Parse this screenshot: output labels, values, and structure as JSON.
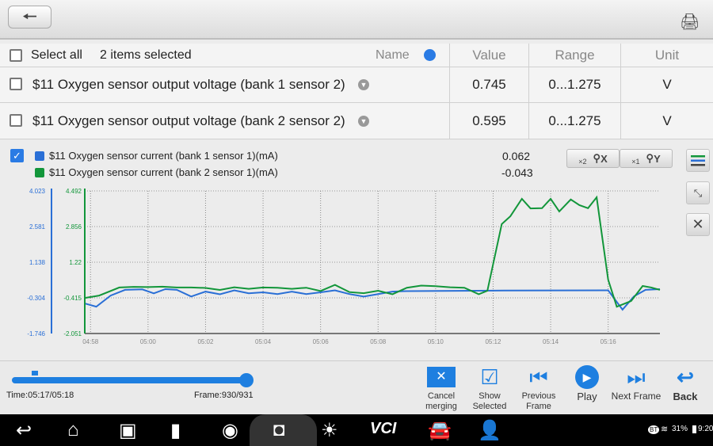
{
  "header": {
    "back_icon": "back-arrow-icon",
    "print_icon": "printer-icon"
  },
  "table": {
    "select_all": "Select all",
    "selected_count": "2 items selected",
    "columns": {
      "name": "Name",
      "value": "Value",
      "range": "Range",
      "unit": "Unit"
    },
    "rows": [
      {
        "name": "$11 Oxygen sensor output voltage (bank 1 sensor 2)",
        "value": "0.745",
        "range": "0...1.275",
        "unit": "V"
      },
      {
        "name": "$11 Oxygen sensor output voltage (bank 2 sensor 2)",
        "value": "0.595",
        "range": "0...1.275",
        "unit": "V"
      }
    ]
  },
  "graph": {
    "legend": [
      {
        "label": "$11 Oxygen sensor current (bank 1 sensor 1)(mA)",
        "value": "0.062",
        "color": "#2a6fd6"
      },
      {
        "label": "$11 Oxygen sensor current (bank 2 sensor 1)(mA)",
        "value": "-0.043",
        "color": "#12963a"
      }
    ],
    "zoom_x": {
      "mult": "×2",
      "label": "X"
    },
    "zoom_y": {
      "mult": "×1",
      "label": "Y"
    }
  },
  "chart_data": {
    "type": "line",
    "x_ticks": [
      "04:58",
      "05:00",
      "05:02",
      "05:04",
      "05:06",
      "05:08",
      "05:10",
      "05:12",
      "05:14",
      "05:16"
    ],
    "xlim": [
      "04:57.8",
      "05:17.8"
    ],
    "grid": true,
    "series": [
      {
        "name": "$11 Oxygen sensor current (bank 1 sensor 1)(mA)",
        "color": "#2a6fd6",
        "ylim": [
          -1.746,
          4.023
        ],
        "y_ticks": [
          "4.023",
          "2.581",
          "1.138",
          "-0.304",
          "-1.746"
        ],
        "points": [
          [
            "04:57.8",
            -0.53
          ],
          [
            "04:58.2",
            -0.66
          ],
          [
            "04:58.7",
            -0.21
          ],
          [
            "04:59.2",
            0.02
          ],
          [
            "04:59.8",
            0.04
          ],
          [
            "05:00.2",
            -0.12
          ],
          [
            "05:00.6",
            0.05
          ],
          [
            "05:01.0",
            0.02
          ],
          [
            "05:01.5",
            -0.25
          ],
          [
            "05:02.0",
            -0.05
          ],
          [
            "05:02.5",
            -0.16
          ],
          [
            "05:03.0",
            0.0
          ],
          [
            "05:03.5",
            -0.12
          ],
          [
            "05:04.0",
            -0.08
          ],
          [
            "05:04.5",
            -0.15
          ],
          [
            "05:05.0",
            -0.05
          ],
          [
            "05:05.5",
            -0.15
          ],
          [
            "05:06.0",
            -0.08
          ],
          [
            "05:06.5",
            0.0
          ],
          [
            "05:07.0",
            -0.15
          ],
          [
            "05:07.5",
            -0.25
          ],
          [
            "05:08.0",
            -0.15
          ],
          [
            "05:08.5",
            -0.05
          ],
          [
            "05:09.0",
            -0.03
          ],
          [
            "05:12.0",
            -0.01
          ],
          [
            "05:16.0",
            0.0
          ],
          [
            "05:16.5",
            -0.78
          ],
          [
            "05:16.9",
            -0.24
          ],
          [
            "05:17.3",
            0.02
          ],
          [
            "05:17.8",
            0.05
          ]
        ]
      },
      {
        "name": "$11 Oxygen sensor current (bank 2 sensor 1)(mA)",
        "color": "#12963a",
        "ylim": [
          -2.051,
          4.492
        ],
        "y_ticks": [
          "4.492",
          "2.856",
          "1.22",
          "-0.415",
          "-2.051"
        ],
        "points": [
          [
            "04:57.8",
            -0.42
          ],
          [
            "04:58.3",
            -0.31
          ],
          [
            "04:59.0",
            0.06
          ],
          [
            "04:59.5",
            0.09
          ],
          [
            "05:00.0",
            0.08
          ],
          [
            "05:00.5",
            0.1
          ],
          [
            "05:01.0",
            0.06
          ],
          [
            "05:01.5",
            0.06
          ],
          [
            "05:02.0",
            0.04
          ],
          [
            "05:02.5",
            -0.05
          ],
          [
            "05:03.0",
            0.07
          ],
          [
            "05:03.5",
            0.0
          ],
          [
            "05:04.0",
            0.06
          ],
          [
            "05:04.5",
            0.05
          ],
          [
            "05:05.0",
            0.0
          ],
          [
            "05:05.5",
            0.05
          ],
          [
            "05:06.0",
            -0.1
          ],
          [
            "05:06.5",
            0.18
          ],
          [
            "05:07.0",
            -0.15
          ],
          [
            "05:07.5",
            -0.2
          ],
          [
            "05:08.0",
            -0.09
          ],
          [
            "05:08.5",
            -0.25
          ],
          [
            "05:09.0",
            0.05
          ],
          [
            "05:09.5",
            0.15
          ],
          [
            "05:10.0",
            0.12
          ],
          [
            "05:10.5",
            0.07
          ],
          [
            "05:11.0",
            0.05
          ],
          [
            "05:11.5",
            -0.25
          ],
          [
            "05:11.8",
            -0.09
          ],
          [
            "05:12.3",
            2.97
          ],
          [
            "05:12.6",
            3.33
          ],
          [
            "05:13.0",
            4.13
          ],
          [
            "05:13.3",
            3.69
          ],
          [
            "05:13.7",
            3.7
          ],
          [
            "05:14.0",
            4.13
          ],
          [
            "05:14.3",
            3.55
          ],
          [
            "05:14.7",
            4.1
          ],
          [
            "05:15.0",
            3.84
          ],
          [
            "05:15.3",
            3.7
          ],
          [
            "05:15.6",
            4.2
          ],
          [
            "05:16.0",
            0.42
          ],
          [
            "05:16.3",
            -0.82
          ],
          [
            "05:16.8",
            -0.56
          ],
          [
            "05:17.2",
            0.13
          ],
          [
            "05:17.5",
            0.06
          ],
          [
            "05:17.8",
            -0.05
          ]
        ]
      }
    ]
  },
  "playback": {
    "time": "Time:05:17/05:18",
    "frame": "Frame:930/931",
    "progress": 0.999
  },
  "toolbar": [
    {
      "label": "Cancel merging",
      "icon": "cancel-merge-icon"
    },
    {
      "label": "Show Selected",
      "icon": "show-selected-icon"
    },
    {
      "label": "Previous Frame",
      "icon": "previous-frame-icon"
    },
    {
      "label": "Play",
      "icon": "play-icon"
    },
    {
      "label": "Next Frame",
      "icon": "next-frame-icon"
    },
    {
      "label": "Back",
      "icon": "back-icon"
    }
  ],
  "statusbar": {
    "bt": "BT",
    "battery": "31%",
    "clock": "9:20",
    "vci": "VCI"
  }
}
